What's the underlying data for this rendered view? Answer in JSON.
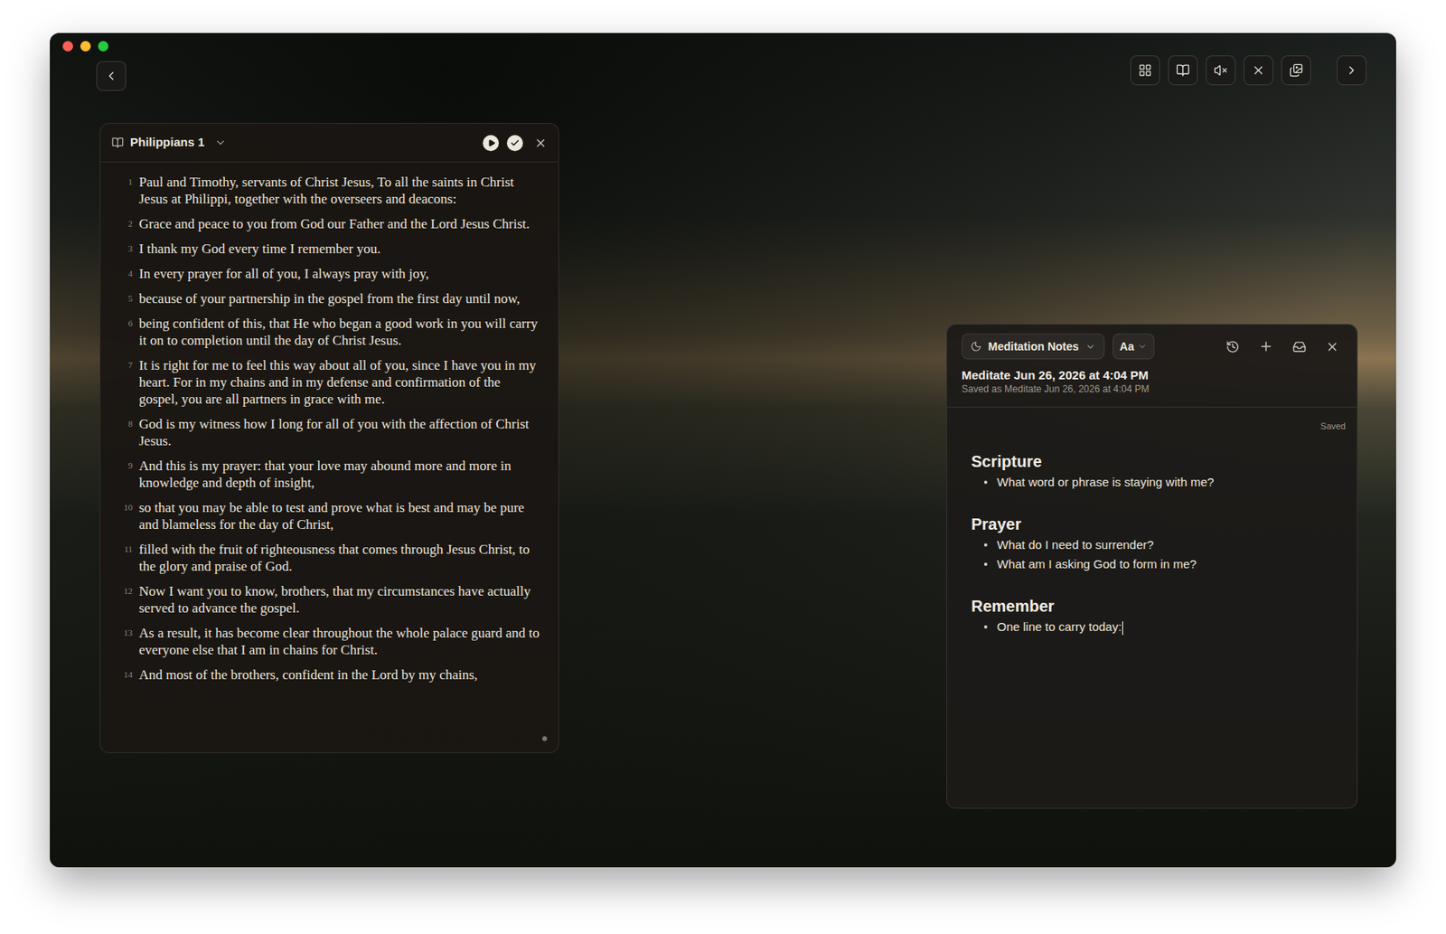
{
  "window": {
    "traffic_lights": [
      {
        "name": "close",
        "color": "#ff5f57"
      },
      {
        "name": "minimize",
        "color": "#febc2e"
      },
      {
        "name": "zoom",
        "color": "#28c840"
      }
    ]
  },
  "reader": {
    "title": "Philippians 1",
    "verses": [
      {
        "number": "1",
        "text": "Paul and Timothy, servants of Christ Jesus, To all the saints in Christ Jesus at Philippi, together with the overseers and deacons:"
      },
      {
        "number": "2",
        "text": "Grace and peace to you from God our Father and the Lord Jesus Christ."
      },
      {
        "number": "3",
        "text": "I thank my God every time I remember you."
      },
      {
        "number": "4",
        "text": "In every prayer for all of you, I always pray with joy,"
      },
      {
        "number": "5",
        "text": "because of your partnership in the gospel from the first day until now,"
      },
      {
        "number": "6",
        "text": "being confident of this, that He who began a good work in you will carry it on to completion until the day of Christ Jesus."
      },
      {
        "number": "7",
        "text": "It is right for me to feel this way about all of you, since I have you in my heart. For in my chains and in my defense and confirmation of the gospel, you are all partners in grace with me."
      },
      {
        "number": "8",
        "text": "God is my witness how I long for all of you with the affection of Christ Jesus."
      },
      {
        "number": "9",
        "text": "And this is my prayer: that your love may abound more and more in knowledge and depth of insight,"
      },
      {
        "number": "10",
        "text": "so that you may be able to test and prove what is best and may be pure and blameless for the day of Christ,"
      },
      {
        "number": "11",
        "text": "filled with the fruit of righteousness that comes through Jesus Christ, to the glory and praise of God."
      },
      {
        "number": "12",
        "text": "Now I want you to know, brothers, that my circumstances have actually served to advance the gospel."
      },
      {
        "number": "13",
        "text": "As a result, it has become clear throughout the whole palace guard and to everyone else that I am in chains for Christ."
      },
      {
        "number": "14",
        "text": "And most of the brothers, confident in the Lord by my chains,"
      }
    ]
  },
  "notes": {
    "template": "Meditation Notes",
    "font_button": "Aa",
    "title": "Meditate Jun 26, 2026 at 4:04 PM",
    "subtitle": "Saved as Meditate Jun 26, 2026 at 4:04 PM",
    "status": "Saved",
    "sections": [
      {
        "heading": "Scripture",
        "prompts": [
          {
            "text": "What word or phrase is staying with me?",
            "caret": false
          }
        ]
      },
      {
        "heading": "Prayer",
        "prompts": [
          {
            "text": "What do I need to surrender?",
            "caret": false
          },
          {
            "text": "What am I asking God to form in me?",
            "caret": false
          }
        ]
      },
      {
        "heading": "Remember",
        "prompts": [
          {
            "text": "One line to carry today:",
            "caret": true
          }
        ]
      }
    ]
  }
}
